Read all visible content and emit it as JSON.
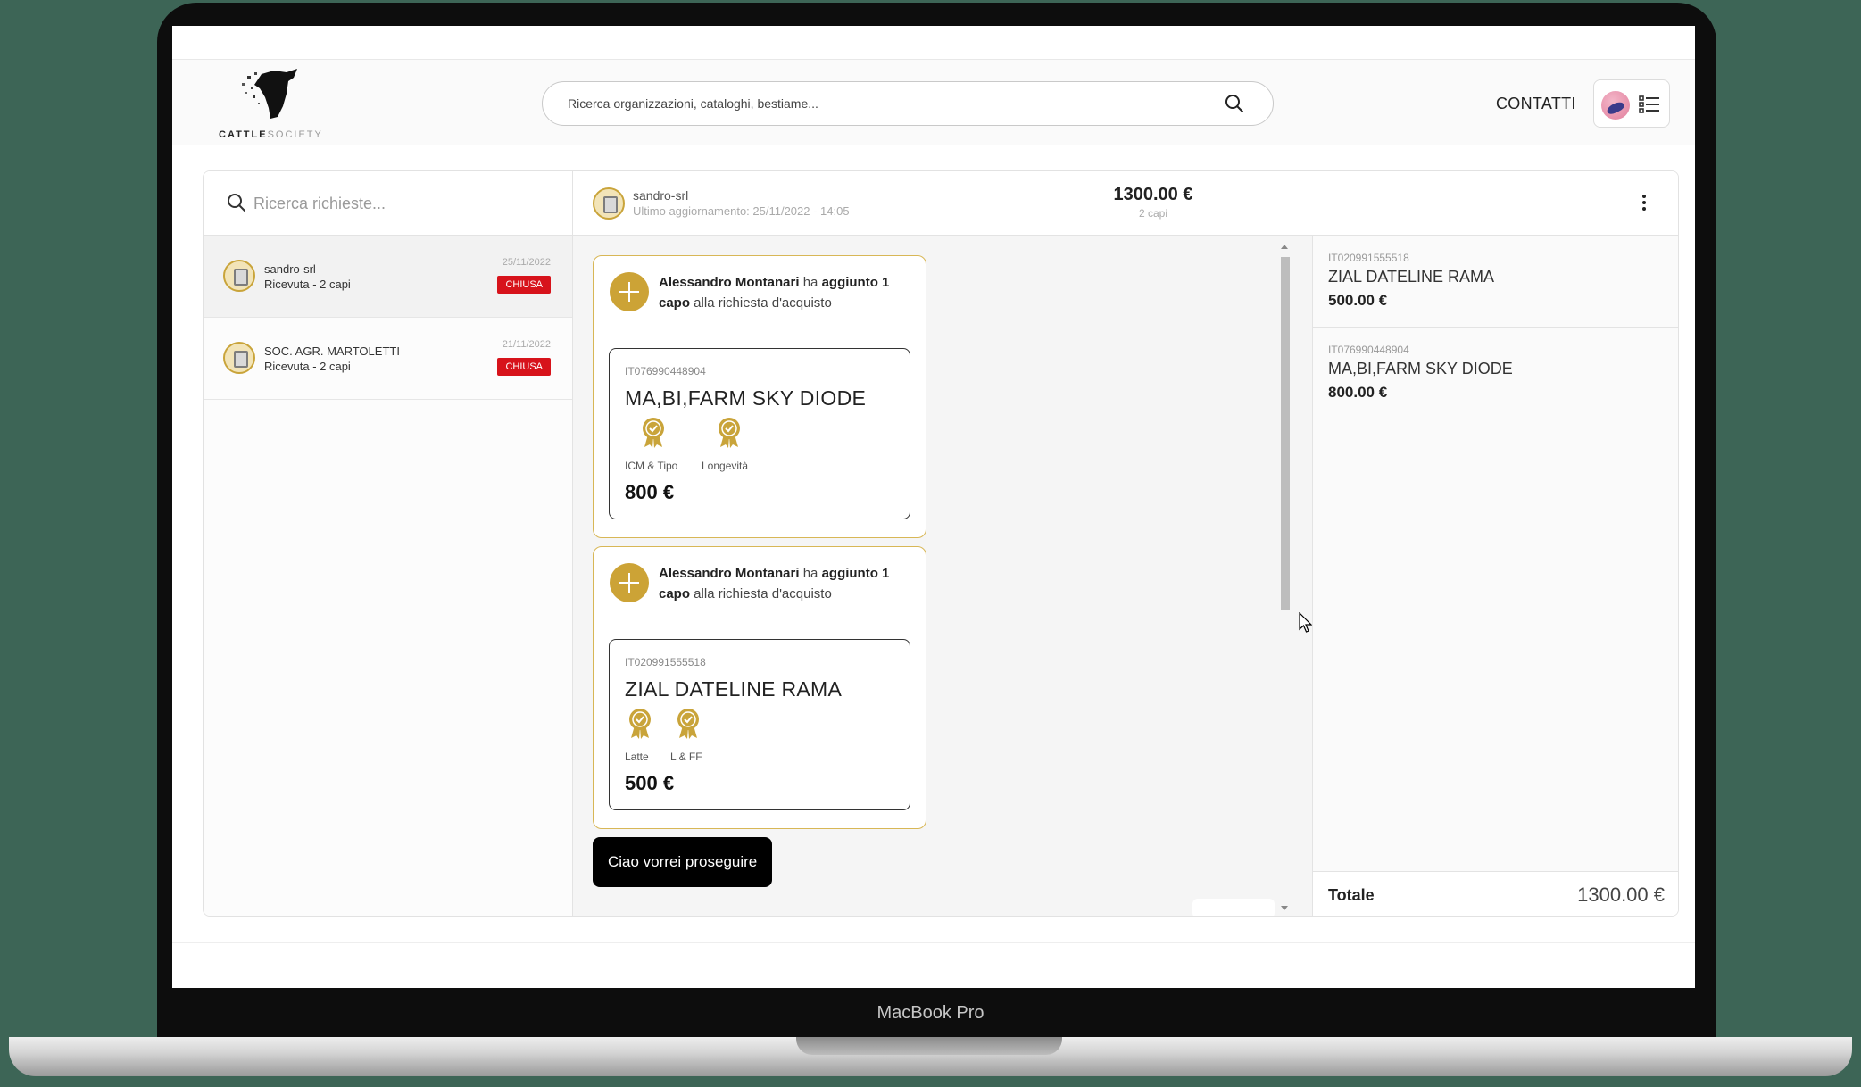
{
  "device": {
    "brand": "MacBook Pro"
  },
  "header": {
    "logo_text_main": "CATTLE",
    "logo_text_sub": "SOCIETY",
    "search_placeholder": "Ricerca organizzazioni, cataloghi, bestiame...",
    "contacts_label": "CONTATTI"
  },
  "requests": {
    "search_placeholder": "Ricerca richieste...",
    "items": [
      {
        "name": "sandro-srl",
        "subtitle": "Ricevuta - 2 capi",
        "date": "25/11/2022",
        "status": "CHIUSA"
      },
      {
        "name": "SOC. AGR. MARTOLETTI",
        "subtitle": "Ricevuta - 2 capi",
        "date": "21/11/2022",
        "status": "CHIUSA"
      }
    ]
  },
  "conversation": {
    "name": "sandro-srl",
    "last_update": "Ultimo aggiornamento: 25/11/2022 - 14:05",
    "total": "1300.00 €",
    "count": "2 capi",
    "events": [
      {
        "actor": "Alessandro Montanari",
        "verb": " ha ",
        "action": "aggiunto 1 capo",
        "rest": " alla richiesta d'acquisto",
        "animal": {
          "id": "IT076990448904",
          "name": "MA,BI,FARM SKY DIODE",
          "awards": [
            "ICM & Tipo",
            "Longevità"
          ],
          "price": "800 €"
        }
      },
      {
        "actor": "Alessandro Montanari",
        "verb": " ha ",
        "action": "aggiunto 1 capo",
        "rest": " alla richiesta d'acquisto",
        "animal": {
          "id": "IT020991555518",
          "name": "ZIAL DATELINE RAMA",
          "awards": [
            "Latte",
            "L & FF"
          ],
          "price": "500 €"
        }
      }
    ],
    "chat_message": "Ciao vorrei proseguire"
  },
  "summary": {
    "items": [
      {
        "id": "IT020991555518",
        "name": "ZIAL DATELINE RAMA",
        "price": "500.00 €"
      },
      {
        "id": "IT076990448904",
        "name": "MA,BI,FARM SKY DIODE",
        "price": "800.00 €"
      }
    ],
    "total_label": "Totale",
    "total_value": "1300.00 €"
  },
  "colors": {
    "accent": "#cca336",
    "status_closed": "#d7131b",
    "chat_bubble": "#000000"
  }
}
